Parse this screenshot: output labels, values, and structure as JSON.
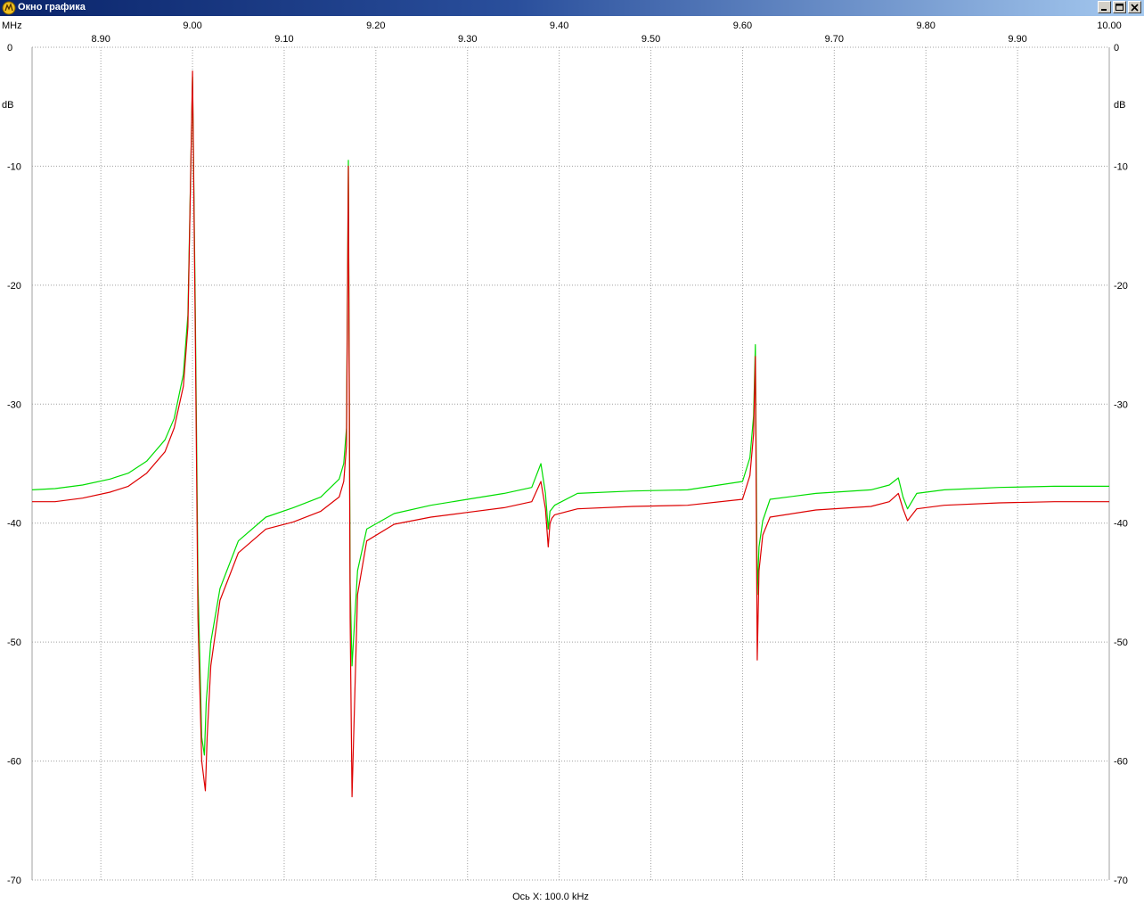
{
  "window": {
    "title": "Окно графика",
    "buttons": [
      "minimize",
      "maximize",
      "close"
    ]
  },
  "chart_data": {
    "type": "line",
    "x_unit": "MHz",
    "y_unit": "dB",
    "xlabel": "Ось X: 100.0 kHz",
    "xlim": [
      8.825,
      10.0
    ],
    "ylim": [
      -70,
      0
    ],
    "x_ticks": [
      "8.90",
      "9.00",
      "9.10",
      "9.20",
      "9.30",
      "9.40",
      "9.50",
      "9.60",
      "9.70",
      "9.80",
      "9.90",
      "10.00"
    ],
    "y_ticks": [
      "0",
      "-10",
      "-20",
      "-30",
      "-40",
      "-50",
      "-60",
      "-70"
    ],
    "grid": true,
    "colors": {
      "green_series": "#00dd00",
      "red_series": "#dd0000",
      "grid": "#a0a0a0"
    },
    "series": [
      {
        "color": "green",
        "x": [
          8.825,
          8.85,
          8.88,
          8.91,
          8.93,
          8.95,
          8.97,
          8.98,
          8.99,
          8.995,
          9.0,
          9.003,
          9.006,
          9.01,
          9.013,
          9.015,
          9.02,
          9.03,
          9.05,
          9.08,
          9.11,
          9.14,
          9.16,
          9.165,
          9.168,
          9.17,
          9.172,
          9.174,
          9.18,
          9.19,
          9.22,
          9.26,
          9.3,
          9.34,
          9.37,
          9.38,
          9.385,
          9.388,
          9.39,
          9.392,
          9.395,
          9.42,
          9.48,
          9.54,
          9.6,
          9.608,
          9.612,
          9.614,
          9.616,
          9.618,
          9.622,
          9.63,
          9.68,
          9.74,
          9.76,
          9.77,
          9.775,
          9.78,
          9.79,
          9.82,
          9.88,
          9.94,
          10.0
        ],
        "y": [
          -37.2,
          -37.1,
          -36.8,
          -36.3,
          -35.8,
          -34.8,
          -33.0,
          -31.2,
          -27.5,
          -22.5,
          -2.5,
          -22.0,
          -45.0,
          -58.0,
          -59.5,
          -55.0,
          -50.0,
          -45.5,
          -41.5,
          -39.5,
          -38.7,
          -37.8,
          -36.3,
          -35.0,
          -32.0,
          -9.5,
          -45.0,
          -52.0,
          -44.0,
          -40.5,
          -39.2,
          -38.5,
          -38.0,
          -37.5,
          -37.0,
          -35.0,
          -37.5,
          -40.5,
          -39.0,
          -38.8,
          -38.5,
          -37.5,
          -37.3,
          -37.2,
          -36.5,
          -34.5,
          -31.0,
          -25.0,
          -46.0,
          -42.0,
          -39.8,
          -38.0,
          -37.5,
          -37.2,
          -36.8,
          -36.2,
          -37.8,
          -38.8,
          -37.5,
          -37.2,
          -37.0,
          -36.9,
          -36.9
        ]
      },
      {
        "color": "red",
        "x": [
          8.825,
          8.85,
          8.88,
          8.91,
          8.93,
          8.95,
          8.97,
          8.98,
          8.99,
          8.995,
          9.0,
          9.003,
          9.006,
          9.01,
          9.014,
          9.016,
          9.02,
          9.03,
          9.05,
          9.08,
          9.11,
          9.14,
          9.16,
          9.165,
          9.168,
          9.17,
          9.172,
          9.174,
          9.18,
          9.19,
          9.22,
          9.26,
          9.3,
          9.34,
          9.37,
          9.38,
          9.385,
          9.388,
          9.39,
          9.392,
          9.395,
          9.42,
          9.48,
          9.54,
          9.6,
          9.608,
          9.612,
          9.614,
          9.616,
          9.618,
          9.622,
          9.63,
          9.68,
          9.74,
          9.76,
          9.77,
          9.775,
          9.78,
          9.79,
          9.82,
          9.88,
          9.94,
          10.0
        ],
        "y": [
          -38.2,
          -38.2,
          -37.9,
          -37.4,
          -36.9,
          -35.8,
          -34.0,
          -32.0,
          -28.5,
          -23.5,
          -2.0,
          -24.0,
          -48.0,
          -60.0,
          -62.5,
          -58.0,
          -52.0,
          -46.5,
          -42.5,
          -40.5,
          -39.9,
          -39.0,
          -37.8,
          -36.5,
          -33.5,
          -10.0,
          -48.0,
          -63.0,
          -46.0,
          -41.5,
          -40.1,
          -39.5,
          -39.1,
          -38.7,
          -38.2,
          -36.5,
          -38.8,
          -42.0,
          -40.0,
          -39.6,
          -39.3,
          -38.8,
          -38.6,
          -38.5,
          -38.0,
          -36.0,
          -32.5,
          -26.0,
          -51.5,
          -44.0,
          -41.0,
          -39.5,
          -38.9,
          -38.6,
          -38.2,
          -37.5,
          -38.8,
          -39.8,
          -38.8,
          -38.5,
          -38.3,
          -38.2,
          -38.2
        ]
      }
    ]
  }
}
